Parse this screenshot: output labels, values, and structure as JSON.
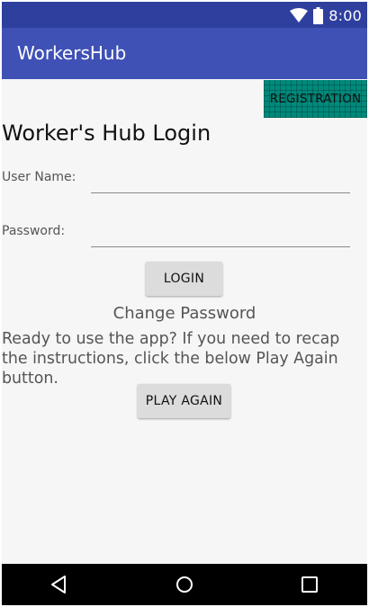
{
  "status_bar": {
    "time": "8:00",
    "icons": [
      "wifi-icon",
      "battery-icon"
    ]
  },
  "app_bar": {
    "title": "WorkersHub"
  },
  "registration": {
    "label": "REGISTRATION"
  },
  "login_form": {
    "heading": "Worker's Hub Login",
    "username_label": "User Name:",
    "username_value": "",
    "password_label": "Password:",
    "password_value": "",
    "login_label": "LOGIN",
    "change_password_label": "Change Password"
  },
  "instructions": {
    "text": "Ready to use the app? If you need to recap the instructions, click the below Play Again button.",
    "play_again_label": "PLAY AGAIN"
  },
  "nav_bar": {
    "icons": [
      "back-icon",
      "home-icon",
      "recents-icon"
    ]
  },
  "colors": {
    "status_bar": "#2f3f9e",
    "app_bar": "#3f51b5",
    "registration_button": "#00897b",
    "button": "#dcdcdc",
    "background": "#f6f6f6"
  }
}
